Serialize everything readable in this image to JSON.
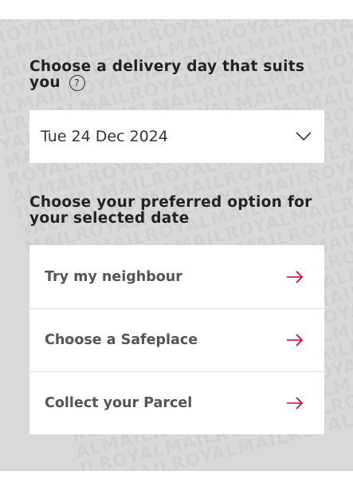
{
  "delivery_day": {
    "heading": "Choose a delivery day that suits you",
    "help_glyph": "?",
    "selected_date": "Tue 24 Dec 2024"
  },
  "options_section": {
    "heading": "Choose your preferred option for your selected date",
    "items": [
      {
        "label": "Try my neighbour",
        "icon": "arrow-right-icon"
      },
      {
        "label": "Choose a Safeplace",
        "icon": "arrow-right-icon"
      },
      {
        "label": "Collect your Parcel",
        "icon": "arrow-right-icon"
      }
    ]
  },
  "colors": {
    "background": "#d9d9d9",
    "accent_arrow": "#d4002a",
    "heading_text": "#222222"
  },
  "watermark_text": "ROYALMAIL"
}
